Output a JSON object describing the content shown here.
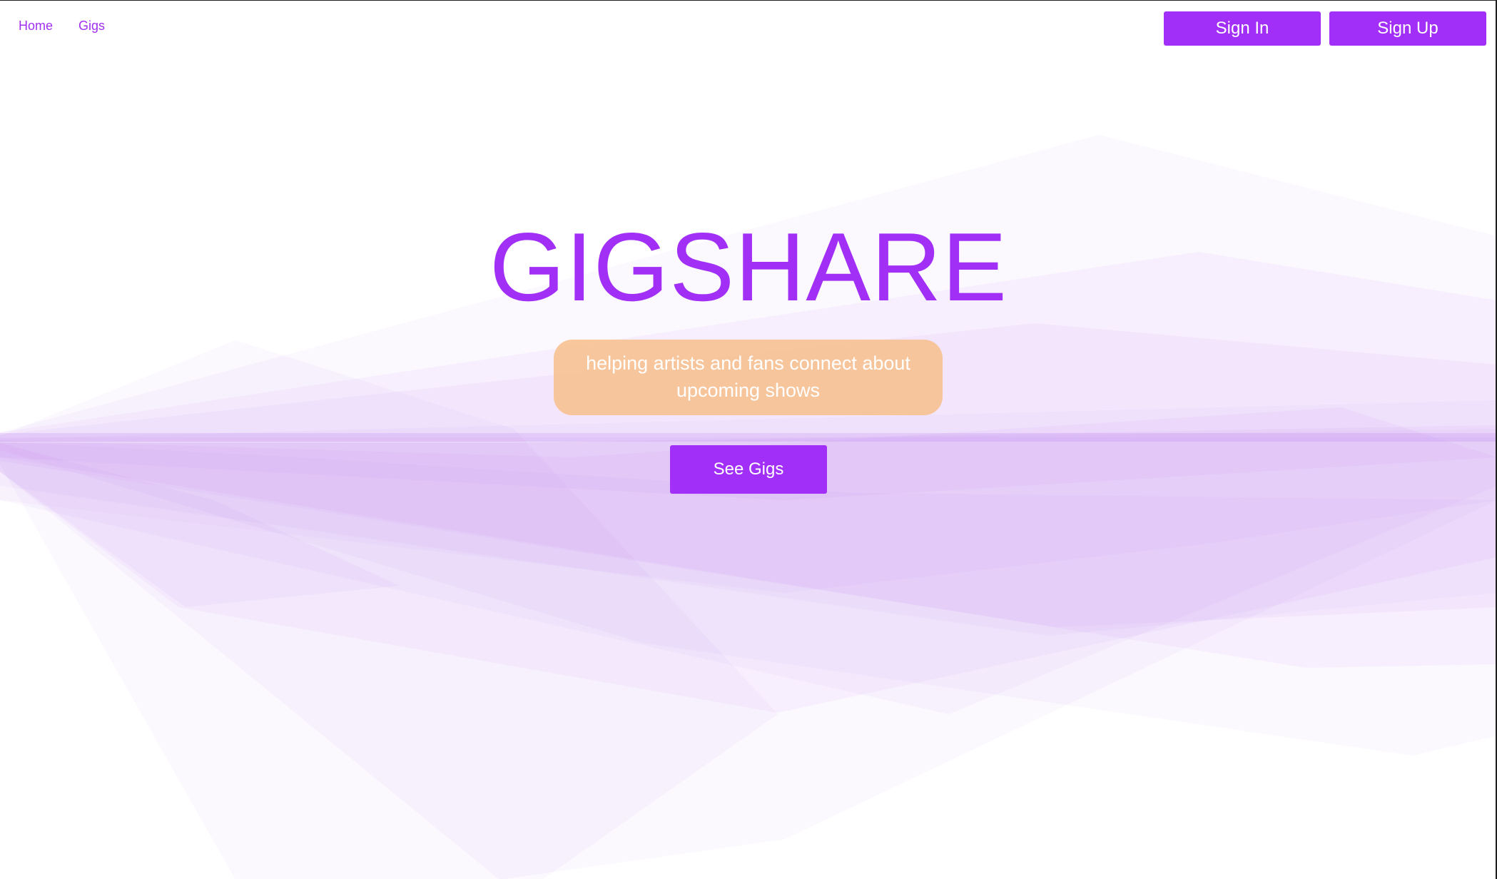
{
  "nav": {
    "links": [
      {
        "label": "Home"
      },
      {
        "label": "Gigs"
      }
    ],
    "sign_in_label": "Sign In",
    "sign_up_label": "Sign Up"
  },
  "hero": {
    "title": "GIGSHARE",
    "tagline": "helping artists and fans connect about upcoming shows",
    "cta_label": "See Gigs"
  },
  "colors": {
    "accent": "#a12ff7",
    "tagline_bg": "#f7c294",
    "background_art": "#c98af2"
  }
}
